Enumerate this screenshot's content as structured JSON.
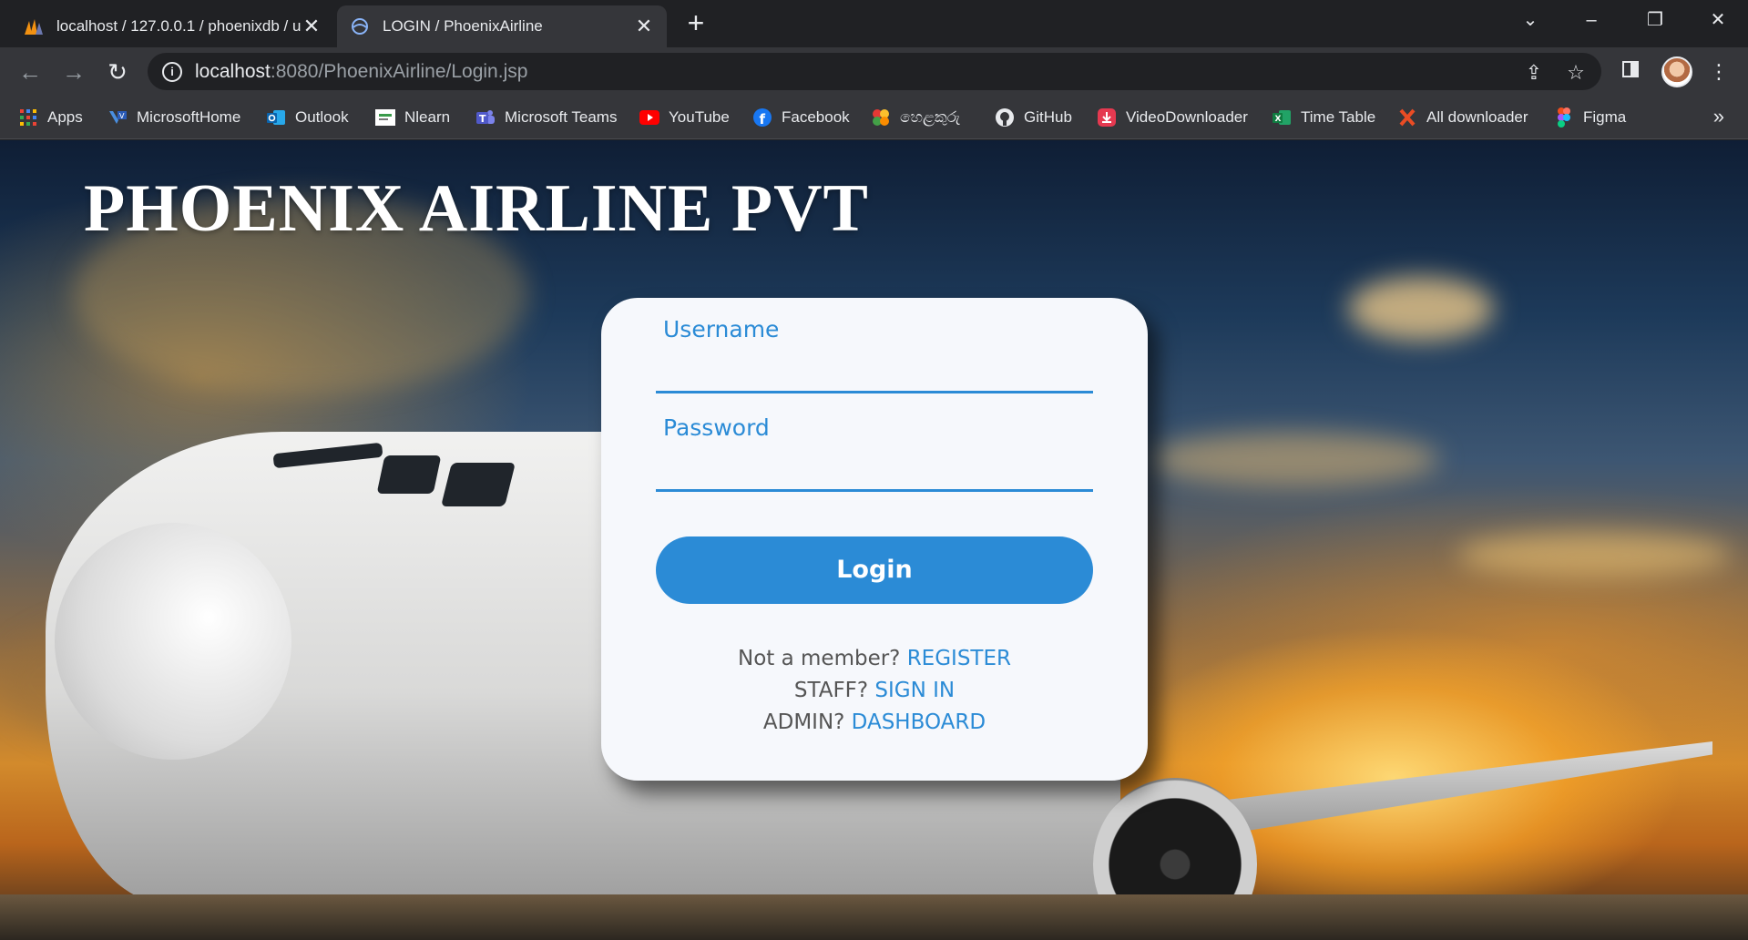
{
  "browser": {
    "tabs": [
      {
        "title": "localhost / 127.0.0.1 / phoenixdb / u",
        "icon": "phpmyadmin-icon",
        "active": false
      },
      {
        "title": "LOGIN / PhoenixAirline",
        "icon": "globe-icon",
        "active": true
      }
    ],
    "address": {
      "host": "localhost",
      "path": ":8080/PhoenixAirline/Login.jsp"
    },
    "bookmarks": [
      {
        "label": "Apps",
        "icon": "apps-grid-icon"
      },
      {
        "label": "MicrosoftHome",
        "icon": "microsoft-icon"
      },
      {
        "label": "Outlook",
        "icon": "outlook-icon"
      },
      {
        "label": "Nlearn",
        "icon": "nlearn-icon"
      },
      {
        "label": "Microsoft Teams",
        "icon": "teams-icon"
      },
      {
        "label": "YouTube",
        "icon": "youtube-icon"
      },
      {
        "label": "Facebook",
        "icon": "facebook-icon"
      },
      {
        "label": "හෙළකුරු",
        "icon": "helakuru-icon"
      },
      {
        "label": "GitHub",
        "icon": "github-icon"
      },
      {
        "label": "VideoDownloader",
        "icon": "download-icon"
      },
      {
        "label": "Time Table",
        "icon": "excel-icon"
      },
      {
        "label": "All downloader",
        "icon": "x-downloader-icon"
      },
      {
        "label": "Figma",
        "icon": "figma-icon"
      }
    ]
  },
  "page": {
    "site_title": "PHOENIX AIRLINE PVT",
    "form": {
      "username_label": "Username",
      "username_value": "",
      "password_label": "Password",
      "password_value": "",
      "login_label": "Login"
    },
    "links": [
      {
        "prefix": "Not a member? ",
        "link": "REGISTER"
      },
      {
        "prefix": "STAFF? ",
        "link": "SIGN IN"
      },
      {
        "prefix": "ADMIN? ",
        "link": "DASHBOARD"
      }
    ]
  },
  "colors": {
    "accent": "#2b8bd6",
    "card": "#f6f8fc",
    "chrome_dark": "#202124",
    "chrome_mid": "#35363a"
  }
}
